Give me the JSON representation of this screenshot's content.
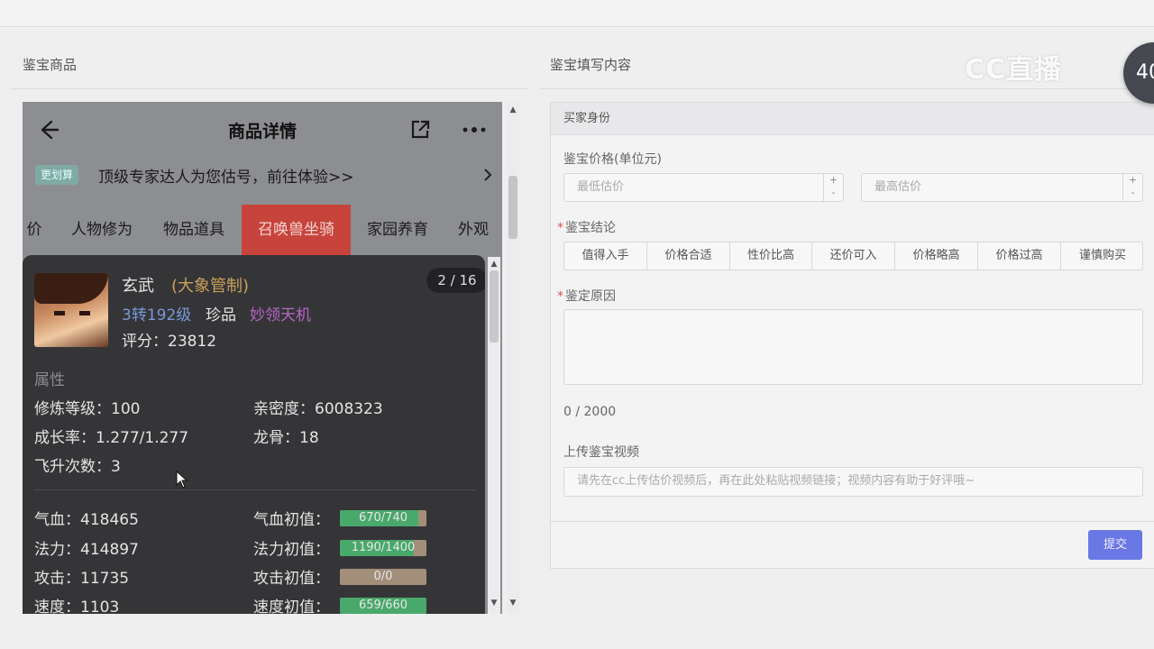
{
  "left_panel": {
    "title": "鉴宝商品"
  },
  "right_panel": {
    "title": "鉴宝填写内容"
  },
  "watermark": "CC直播",
  "floating_badge": "40",
  "phone": {
    "header": {
      "title": "商品详情",
      "icons": [
        "back-arrow-icon",
        "share-icon",
        "more-icon"
      ]
    },
    "notice": {
      "badge": "更划算",
      "text": "顶级专家达人为您估号，前往体验>>"
    },
    "tabs": [
      {
        "label": "价"
      },
      {
        "label": "人物修为"
      },
      {
        "label": "物品道具"
      },
      {
        "label": "召唤兽坐骑",
        "active": true
      },
      {
        "label": "家园养育"
      },
      {
        "label": "外观"
      }
    ],
    "pet": {
      "pager": "2 / 16",
      "name": "玄武",
      "tag": "(大象管制)",
      "level": "3转192级",
      "rank": "珍品",
      "skill": "妙领天机",
      "score": "评分：23812",
      "attr_heading": "属性",
      "attrs": {
        "cultivation": "修炼等级：100",
        "intimacy": "亲密度：6008323",
        "growth": "成长率：1.277/1.277",
        "dragon_bone": "龙骨：18",
        "ascension": "飞升次数：3"
      },
      "stats": [
        {
          "label": "气血：418465",
          "init_label": "气血初值：",
          "bar_text": "670/740",
          "fill": 0.905,
          "color": "#49a86b"
        },
        {
          "label": "法力：414897",
          "init_label": "法力初值：",
          "bar_text": "1190/1400",
          "fill": 0.85,
          "color": "#49a86b"
        },
        {
          "label": "攻击：11735",
          "init_label": "攻击初值：",
          "bar_text": "0/0",
          "fill": 0,
          "color": "#49a86b"
        },
        {
          "label": "速度：1103",
          "init_label": "速度初值：",
          "bar_text": "659/660",
          "fill": 0.998,
          "color": "#49a86b"
        }
      ]
    }
  },
  "form": {
    "section_header": "买家身份",
    "price_label": "鉴宝价格(单位元)",
    "min_placeholder": "最低估价",
    "max_placeholder": "最高估价",
    "conclusion_label": "鉴宝结论",
    "conclusion_options": [
      "值得入手",
      "价格合适",
      "性价比高",
      "还价可入",
      "价格略高",
      "价格过高",
      "谨慎购买"
    ],
    "reason_label": "鉴定原因",
    "reason_counter": "0 / 2000",
    "video_label": "上传鉴宝视频",
    "video_placeholder": "请先在cc上传估价视频后，再在此处粘贴视频链接；视频内容有助于好评哦~",
    "submit_label": "提交"
  }
}
